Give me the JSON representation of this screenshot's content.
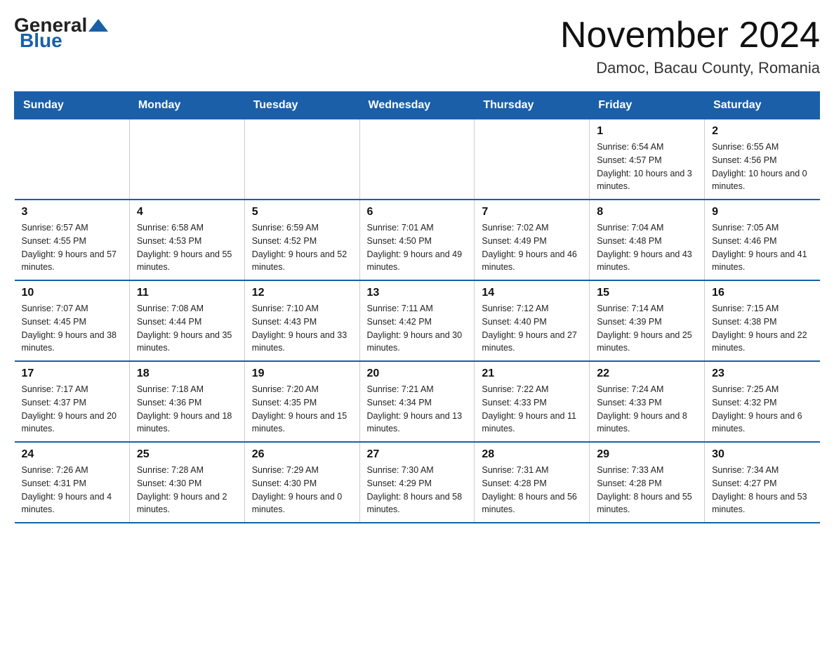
{
  "header": {
    "logo": {
      "text_general": "General",
      "text_blue": "Blue"
    },
    "title": "November 2024",
    "location": "Damoc, Bacau County, Romania"
  },
  "calendar": {
    "days_of_week": [
      "Sunday",
      "Monday",
      "Tuesday",
      "Wednesday",
      "Thursday",
      "Friday",
      "Saturday"
    ],
    "weeks": [
      [
        {
          "day": "",
          "info": ""
        },
        {
          "day": "",
          "info": ""
        },
        {
          "day": "",
          "info": ""
        },
        {
          "day": "",
          "info": ""
        },
        {
          "day": "",
          "info": ""
        },
        {
          "day": "1",
          "info": "Sunrise: 6:54 AM\nSunset: 4:57 PM\nDaylight: 10 hours and 3 minutes."
        },
        {
          "day": "2",
          "info": "Sunrise: 6:55 AM\nSunset: 4:56 PM\nDaylight: 10 hours and 0 minutes."
        }
      ],
      [
        {
          "day": "3",
          "info": "Sunrise: 6:57 AM\nSunset: 4:55 PM\nDaylight: 9 hours and 57 minutes."
        },
        {
          "day": "4",
          "info": "Sunrise: 6:58 AM\nSunset: 4:53 PM\nDaylight: 9 hours and 55 minutes."
        },
        {
          "day": "5",
          "info": "Sunrise: 6:59 AM\nSunset: 4:52 PM\nDaylight: 9 hours and 52 minutes."
        },
        {
          "day": "6",
          "info": "Sunrise: 7:01 AM\nSunset: 4:50 PM\nDaylight: 9 hours and 49 minutes."
        },
        {
          "day": "7",
          "info": "Sunrise: 7:02 AM\nSunset: 4:49 PM\nDaylight: 9 hours and 46 minutes."
        },
        {
          "day": "8",
          "info": "Sunrise: 7:04 AM\nSunset: 4:48 PM\nDaylight: 9 hours and 43 minutes."
        },
        {
          "day": "9",
          "info": "Sunrise: 7:05 AM\nSunset: 4:46 PM\nDaylight: 9 hours and 41 minutes."
        }
      ],
      [
        {
          "day": "10",
          "info": "Sunrise: 7:07 AM\nSunset: 4:45 PM\nDaylight: 9 hours and 38 minutes."
        },
        {
          "day": "11",
          "info": "Sunrise: 7:08 AM\nSunset: 4:44 PM\nDaylight: 9 hours and 35 minutes."
        },
        {
          "day": "12",
          "info": "Sunrise: 7:10 AM\nSunset: 4:43 PM\nDaylight: 9 hours and 33 minutes."
        },
        {
          "day": "13",
          "info": "Sunrise: 7:11 AM\nSunset: 4:42 PM\nDaylight: 9 hours and 30 minutes."
        },
        {
          "day": "14",
          "info": "Sunrise: 7:12 AM\nSunset: 4:40 PM\nDaylight: 9 hours and 27 minutes."
        },
        {
          "day": "15",
          "info": "Sunrise: 7:14 AM\nSunset: 4:39 PM\nDaylight: 9 hours and 25 minutes."
        },
        {
          "day": "16",
          "info": "Sunrise: 7:15 AM\nSunset: 4:38 PM\nDaylight: 9 hours and 22 minutes."
        }
      ],
      [
        {
          "day": "17",
          "info": "Sunrise: 7:17 AM\nSunset: 4:37 PM\nDaylight: 9 hours and 20 minutes."
        },
        {
          "day": "18",
          "info": "Sunrise: 7:18 AM\nSunset: 4:36 PM\nDaylight: 9 hours and 18 minutes."
        },
        {
          "day": "19",
          "info": "Sunrise: 7:20 AM\nSunset: 4:35 PM\nDaylight: 9 hours and 15 minutes."
        },
        {
          "day": "20",
          "info": "Sunrise: 7:21 AM\nSunset: 4:34 PM\nDaylight: 9 hours and 13 minutes."
        },
        {
          "day": "21",
          "info": "Sunrise: 7:22 AM\nSunset: 4:33 PM\nDaylight: 9 hours and 11 minutes."
        },
        {
          "day": "22",
          "info": "Sunrise: 7:24 AM\nSunset: 4:33 PM\nDaylight: 9 hours and 8 minutes."
        },
        {
          "day": "23",
          "info": "Sunrise: 7:25 AM\nSunset: 4:32 PM\nDaylight: 9 hours and 6 minutes."
        }
      ],
      [
        {
          "day": "24",
          "info": "Sunrise: 7:26 AM\nSunset: 4:31 PM\nDaylight: 9 hours and 4 minutes."
        },
        {
          "day": "25",
          "info": "Sunrise: 7:28 AM\nSunset: 4:30 PM\nDaylight: 9 hours and 2 minutes."
        },
        {
          "day": "26",
          "info": "Sunrise: 7:29 AM\nSunset: 4:30 PM\nDaylight: 9 hours and 0 minutes."
        },
        {
          "day": "27",
          "info": "Sunrise: 7:30 AM\nSunset: 4:29 PM\nDaylight: 8 hours and 58 minutes."
        },
        {
          "day": "28",
          "info": "Sunrise: 7:31 AM\nSunset: 4:28 PM\nDaylight: 8 hours and 56 minutes."
        },
        {
          "day": "29",
          "info": "Sunrise: 7:33 AM\nSunset: 4:28 PM\nDaylight: 8 hours and 55 minutes."
        },
        {
          "day": "30",
          "info": "Sunrise: 7:34 AM\nSunset: 4:27 PM\nDaylight: 8 hours and 53 minutes."
        }
      ]
    ]
  }
}
